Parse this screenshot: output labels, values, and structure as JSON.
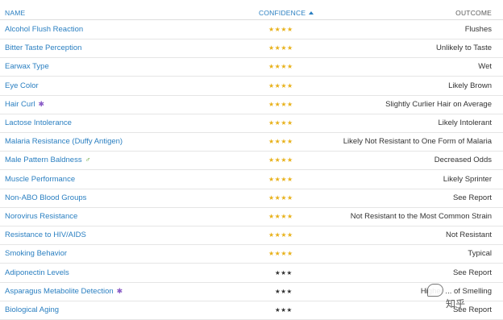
{
  "header": {
    "name": "NAME",
    "confidence": "CONFIDENCE",
    "outcome": "OUTCOME"
  },
  "colors": {
    "link": "#2a7fc1",
    "star_gold": "#e8b11a",
    "star_dark": "#333333"
  },
  "rows": [
    {
      "trait": "Alcohol Flush Reaction",
      "stars": "★★★★",
      "confidence": 4,
      "style": "gold",
      "outcome": "Flushes",
      "icon": ""
    },
    {
      "trait": "Bitter Taste Perception",
      "stars": "★★★★",
      "confidence": 4,
      "style": "gold",
      "outcome": "Unlikely to Taste",
      "icon": ""
    },
    {
      "trait": "Earwax Type",
      "stars": "★★★★",
      "confidence": 4,
      "style": "gold",
      "outcome": "Wet",
      "icon": ""
    },
    {
      "trait": "Eye Color",
      "stars": "★★★★",
      "confidence": 4,
      "style": "gold",
      "outcome": "Likely Brown",
      "icon": ""
    },
    {
      "trait": "Hair Curl",
      "stars": "★★★★",
      "confidence": 4,
      "style": "gold",
      "outcome": "Slightly Curlier Hair on Average",
      "icon": "multi-factor-icon"
    },
    {
      "trait": "Lactose Intolerance",
      "stars": "★★★★",
      "confidence": 4,
      "style": "gold",
      "outcome": "Likely Intolerant",
      "icon": ""
    },
    {
      "trait": "Malaria Resistance (Duffy Antigen)",
      "stars": "★★★★",
      "confidence": 4,
      "style": "gold",
      "outcome": "Likely Not Resistant to One Form of Malaria",
      "icon": ""
    },
    {
      "trait": "Male Pattern Baldness",
      "stars": "★★★★",
      "confidence": 4,
      "style": "gold",
      "outcome": "Decreased Odds",
      "icon": "male-icon"
    },
    {
      "trait": "Muscle Performance",
      "stars": "★★★★",
      "confidence": 4,
      "style": "gold",
      "outcome": "Likely Sprinter",
      "icon": ""
    },
    {
      "trait": "Non-ABO Blood Groups",
      "stars": "★★★★",
      "confidence": 4,
      "style": "gold",
      "outcome": "See Report",
      "icon": ""
    },
    {
      "trait": "Norovirus Resistance",
      "stars": "★★★★",
      "confidence": 4,
      "style": "gold",
      "outcome": "Not Resistant to the Most Common Strain",
      "icon": ""
    },
    {
      "trait": "Resistance to HIV/AIDS",
      "stars": "★★★★",
      "confidence": 4,
      "style": "gold",
      "outcome": "Not Resistant",
      "icon": ""
    },
    {
      "trait": "Smoking Behavior",
      "stars": "★★★★",
      "confidence": 4,
      "style": "gold",
      "outcome": "Typical",
      "icon": ""
    },
    {
      "trait": "Adiponectin Levels",
      "stars": "★★★",
      "confidence": 3,
      "style": "dark",
      "outcome": "See Report",
      "icon": ""
    },
    {
      "trait": "Asparagus Metabolite Detection",
      "stars": "★★★",
      "confidence": 3,
      "style": "dark",
      "outcome": "Higher ... of Smelling",
      "icon": "multi-factor-icon"
    },
    {
      "trait": "Biological Aging",
      "stars": "★★★",
      "confidence": 3,
      "style": "dark",
      "outcome": "See Report",
      "icon": ""
    }
  ],
  "watermark": {
    "text": "知乎",
    "icon": "chat-bubble-icon"
  }
}
